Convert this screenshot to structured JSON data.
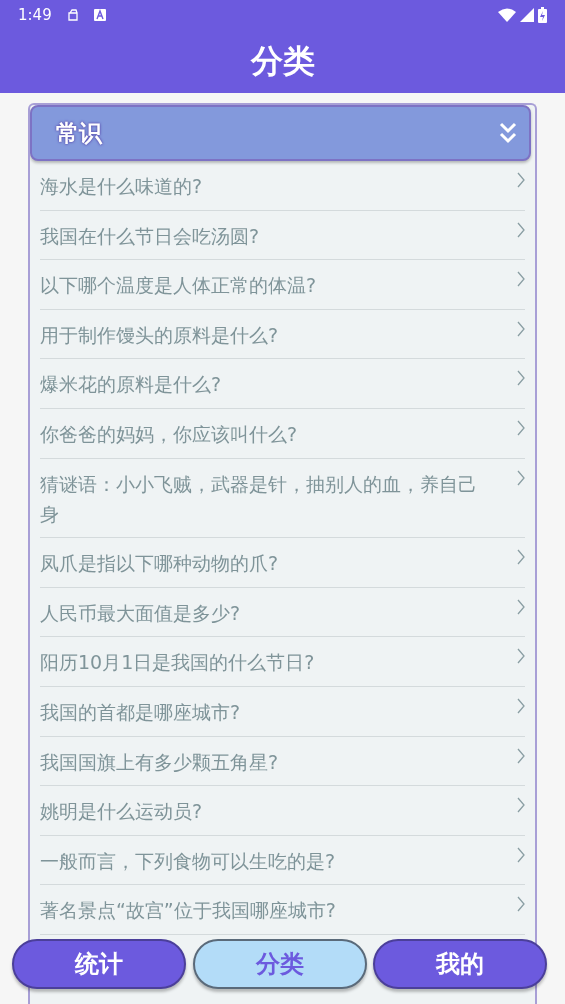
{
  "status_bar": {
    "time": "1:49"
  },
  "header": {
    "title": "分类"
  },
  "category": {
    "title": "常识",
    "expanded": true
  },
  "questions": [
    {
      "text": "海水是什么味道的?"
    },
    {
      "text": "我国在什么节日会吃汤圆?"
    },
    {
      "text": "以下哪个温度是人体正常的体温?"
    },
    {
      "text": "用于制作馒头的原料是什么?"
    },
    {
      "text": "爆米花的原料是什么?"
    },
    {
      "text": "你爸爸的妈妈，你应该叫什么?"
    },
    {
      "text": "猜谜语：小小飞贼，武器是针，抽别人的血，养自己身"
    },
    {
      "text": "凤爪是指以下哪种动物的爪?"
    },
    {
      "text": "人民币最大面值是多少?"
    },
    {
      "text": "阳历10月1日是我国的什么节日?"
    },
    {
      "text": "我国的首都是哪座城市?"
    },
    {
      "text": "我国国旗上有多少颗五角星?"
    },
    {
      "text": "姚明是什么运动员?"
    },
    {
      "text": "一般而言，下列食物可以生吃的是?"
    },
    {
      "text": "著名景点“故宫”位于我国哪座城市?"
    }
  ],
  "nav": [
    {
      "label": "统计",
      "selected": false
    },
    {
      "label": "分类",
      "selected": true
    },
    {
      "label": "我的",
      "selected": false
    }
  ]
}
